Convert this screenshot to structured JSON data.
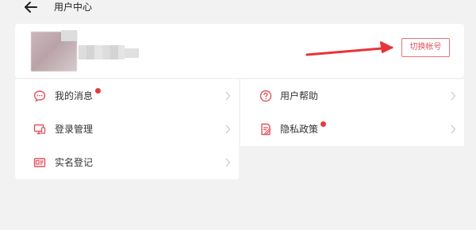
{
  "header": {
    "title": "用户中心",
    "back_icon": "arrow-left-icon"
  },
  "profile": {
    "switch_account_label": "切换帐号"
  },
  "menu": {
    "left": [
      {
        "label": "我的消息",
        "icon": "chat-bubble-icon",
        "badge": true
      },
      {
        "label": "登录管理",
        "icon": "devices-icon",
        "badge": false
      },
      {
        "label": "实名登记",
        "icon": "id-card-icon",
        "badge": false
      }
    ],
    "right": [
      {
        "label": "用户帮助",
        "icon": "question-circle-icon",
        "badge": false
      },
      {
        "label": "隐私政策",
        "icon": "policy-document-icon",
        "badge": true
      }
    ]
  },
  "colors": {
    "accent": "#e05260",
    "badge": "#e23d3d",
    "background": "#f2f2f2",
    "card": "#ffffff",
    "annotation_arrow": "#e8333a"
  }
}
